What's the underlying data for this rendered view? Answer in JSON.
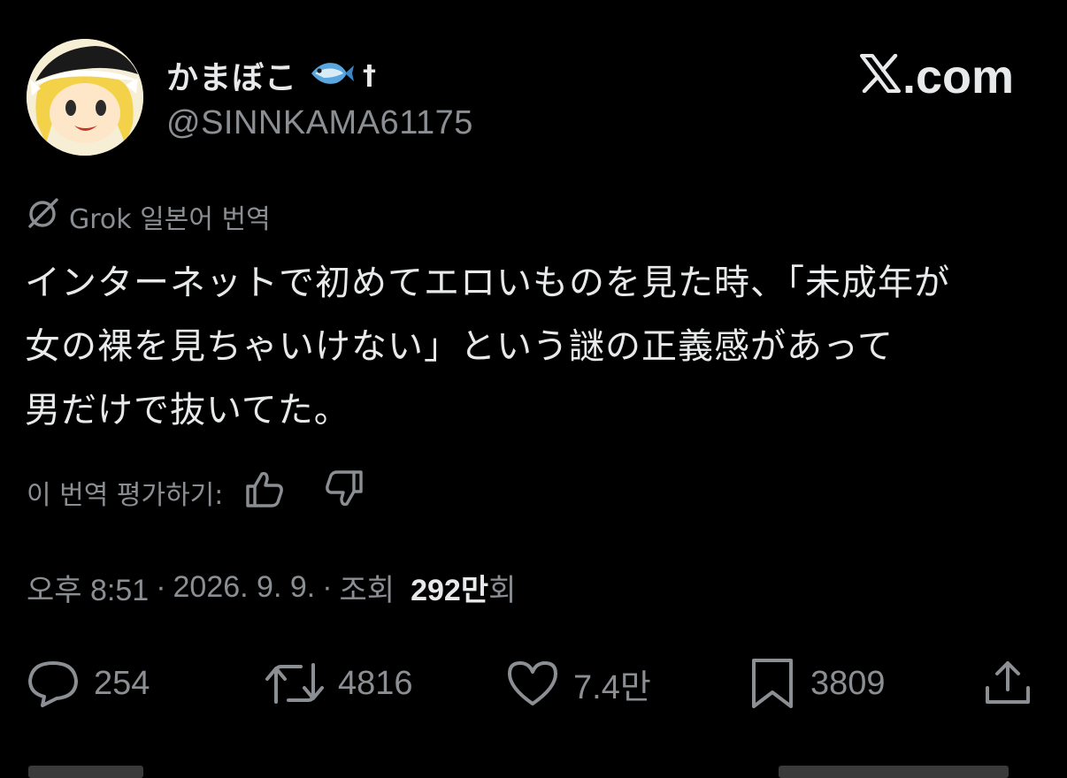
{
  "author": {
    "display_name": "かまぼこ",
    "badge_icon": "fish-icon",
    "suffix_symbol": "†",
    "handle": "@SINNKAMA61175"
  },
  "brand": {
    "label": ".com"
  },
  "translation": {
    "label": "Grok 일본어 번역"
  },
  "tweet": {
    "lines": [
      "インターネットで初めてエロいものを見た時、「未成年が",
      "女の裸を見ちゃいけない」という謎の正義感があって",
      "男だけで抜いてた。"
    ]
  },
  "rating": {
    "label": "이 번역 평가하기:"
  },
  "meta": {
    "time": "오후 8:51",
    "date": "2026. 9. 9.",
    "views_label": "조회",
    "views_number": "292",
    "views_unit": "만",
    "views_suffix": "회"
  },
  "actions": {
    "replies": "254",
    "reposts": "4816",
    "likes": "7.4만",
    "bookmarks": "3809"
  },
  "colors": {
    "background": "#000000",
    "primary_text": "#e7e9ea",
    "secondary_text": "#8b8f94"
  }
}
